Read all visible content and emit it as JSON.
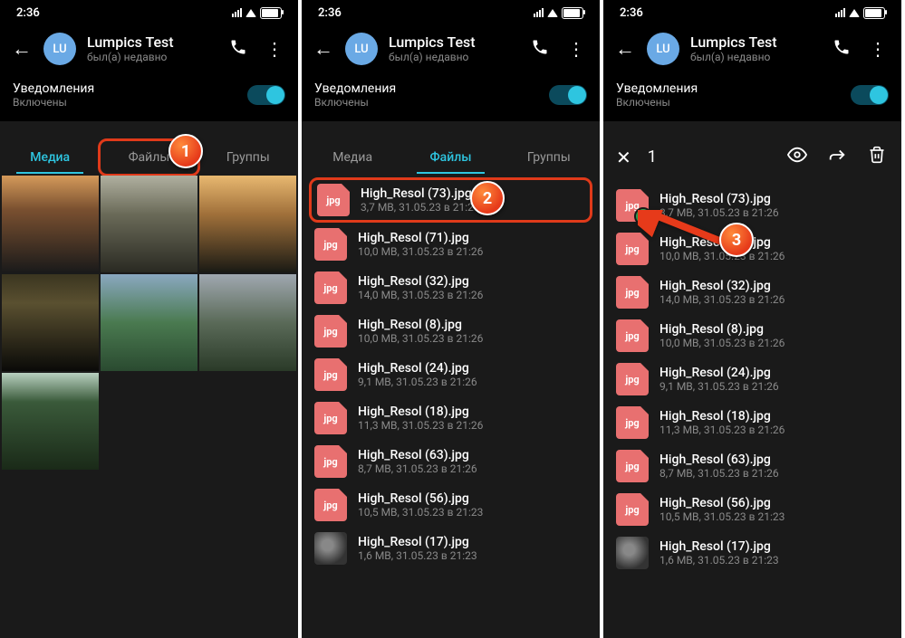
{
  "status_time": "2:36",
  "profile": {
    "avatar_initials": "LU",
    "name": "Lumpics Test",
    "status": "был(а) недавно"
  },
  "notifications": {
    "label": "Уведомления",
    "sub": "Включены"
  },
  "tabs": {
    "media": "Медиа",
    "files": "Файлы",
    "groups": "Группы"
  },
  "selection": {
    "count": "1"
  },
  "files": [
    {
      "name": "High_Resol (73).jpg",
      "meta": "3,7 MB, 31.05.23 в 21:26",
      "ext": "jpg"
    },
    {
      "name": "High_Resol (71).jpg",
      "meta": "10,0 MB, 31.05.23 в 21:26",
      "ext": "jpg"
    },
    {
      "name": "High_Resol (32).jpg",
      "meta": "14,0 MB, 31.05.23 в 21:26",
      "ext": "jpg"
    },
    {
      "name": "High_Resol (8).jpg",
      "meta": "10,0 MB, 31.05.23 в 21:26",
      "ext": "jpg"
    },
    {
      "name": "High_Resol (24).jpg",
      "meta": "9,1 MB, 31.05.23 в 21:26",
      "ext": "jpg"
    },
    {
      "name": "High_Resol (18).jpg",
      "meta": "11,3 MB, 31.05.23 в 21:26",
      "ext": "jpg"
    },
    {
      "name": "High_Resol (63).jpg",
      "meta": "8,7 MB, 31.05.23 в 21:26",
      "ext": "jpg"
    },
    {
      "name": "High_Resol (56).jpg",
      "meta": "10,5 MB, 31.05.23 в 21:23",
      "ext": "jpg"
    },
    {
      "name": "High_Resol (17).jpg",
      "meta": "1,6 MB, 31.05.23 в 21:23",
      "ext": "thumb"
    }
  ],
  "badges": {
    "n1": "1",
    "n2": "2",
    "n3": "3"
  }
}
